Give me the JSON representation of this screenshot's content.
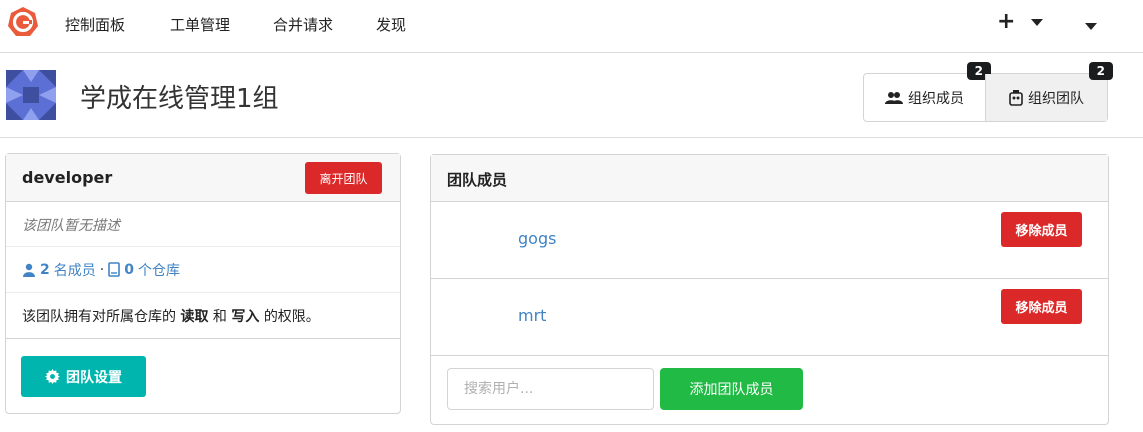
{
  "nav": {
    "items": [
      "控制面板",
      "工单管理",
      "合并请求",
      "发现"
    ],
    "plus": "+"
  },
  "org": {
    "name": "学成在线管理1组",
    "tabs": [
      {
        "label": "组织成员",
        "count": "2",
        "icon": "users-icon"
      },
      {
        "label": "组织团队",
        "count": "2",
        "icon": "team-icon"
      }
    ]
  },
  "team": {
    "name": "developer",
    "leave_label": "离开团队",
    "description": "该团队暂无描述",
    "members_count": "2",
    "members_label": "名成员",
    "separator": "·",
    "repos_count": "0",
    "repos_label": "个仓库",
    "perm_prefix": "该团队拥有对所属仓库的",
    "perm_read": "读取",
    "perm_and": "和",
    "perm_write": "写入",
    "perm_suffix": "的权限。",
    "settings_label": "团队设置"
  },
  "members": {
    "title": "团队成员",
    "rows": [
      {
        "name": "gogs",
        "remove_label": "移除成员"
      },
      {
        "name": "mrt",
        "remove_label": "移除成员"
      }
    ],
    "search_placeholder": "搜索用户...",
    "add_label": "添加团队成员"
  },
  "colors": {
    "red": "#db2828",
    "teal": "#00b5ad",
    "green": "#21ba45",
    "link": "#4183c4"
  }
}
